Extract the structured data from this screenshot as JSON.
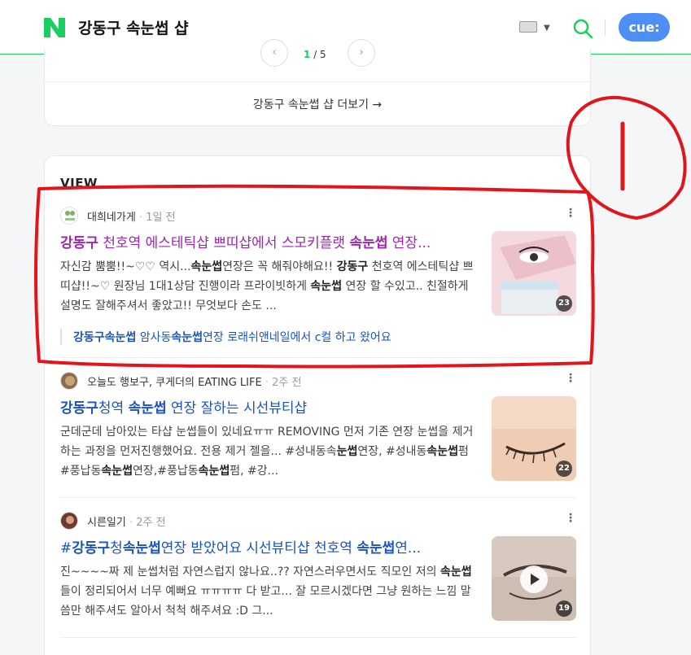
{
  "header": {
    "query": "강동구 속눈썹 샵",
    "cue_label": "cue:"
  },
  "top_card": {
    "pager_current": "1",
    "pager_total": "/ 5",
    "more_link": "강동구 속눈썹 샵 더보기 →"
  },
  "view": {
    "title": "VIEW",
    "posts": [
      {
        "author": "대희네가게",
        "time": "1일 전",
        "title_parts": [
          "강동구",
          " 천호역 에스테틱샵 쁘띠샵에서 스모키플랫 ",
          "속눈썹",
          " 연장..."
        ],
        "body_parts": [
          "자신감 뿜뿜!!~♡♡ 역시...",
          "속눈썹",
          "연장은 꼭 해줘야해요!! ",
          "강동구",
          " 천호역 에스테틱샵 쁘띠샵!!~♡ 원장님 1대1상담 진행이라 프라이빗하게 ",
          "속눈썹",
          " 연장 할 수있고.. 친절하게 설명도 잘해주셔서 좋았고!! 무엇보다 손도 ..."
        ],
        "image_count": "23",
        "sub_parts": [
          "강동구속눈썹",
          " 암사동",
          "속눈썹",
          "연장 로래쉬앤네일에서 c컬 하고 왔어요"
        ]
      },
      {
        "author": "오늘도 행보구, 쿠게더의 EATING LIFE",
        "time": "2주 전",
        "title_parts": [
          "강동구",
          "청역 ",
          "속눈썹",
          " 연장 잘하는 시선뷰티샵"
        ],
        "body_parts": [
          "군데군데 남아있는 타샵 눈썹들이 있네요ㅠㅠ REMOVING 먼저 기존 연장 눈썹을 제거하는 과정을 먼저진행했어요. 전용 제거 젤을... #성내동속",
          "눈썹",
          "연장, #성내동",
          "속눈썹",
          "펌 #풍납동",
          "속눈썹",
          "연장,#풍납동",
          "속눈썹",
          "펌, #강..."
        ],
        "image_count": "22"
      },
      {
        "author": "시른일기",
        "time": "2주 전",
        "title_parts": [
          "#",
          "강동구",
          "청",
          "속눈썹",
          "연장 받았어요 시선뷰티샵 천호역 ",
          "속눈썹",
          "연..."
        ],
        "body_parts": [
          "진~~~~짜 제 눈썹처럼 자연스럽지 않나요..?? 자연스러우면서도 직모인 저의 ",
          "속눈썹",
          "들이 정리되어서 너무 예뻐요 ㅠㅠㅠㅠ 다 받고... 잘 모르시겠다면 그냥 원하는 느낌 말씀만 해주셔도 알아서 척척 해주셔요 :D 그..."
        ],
        "image_count": "19"
      }
    ]
  },
  "colors": {
    "brand_green": "#19ce60",
    "link_blue": "#1a53bd",
    "visited_purple": "#9c27b0",
    "annotation_red": "#e0161b"
  }
}
